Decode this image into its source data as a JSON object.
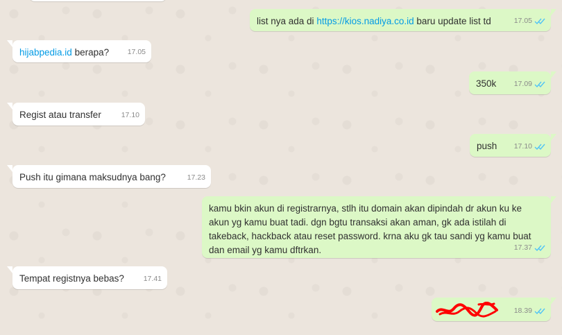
{
  "colors": {
    "background": "#ece5dd",
    "incoming_bubble": "#ffffff",
    "outgoing_bubble": "#dcf8c6",
    "link": "#039be5",
    "read_ticks": "#4fc3f7",
    "redaction": "#ff0000"
  },
  "messages": [
    {
      "direction": "out",
      "text_before": "list nya ada di ",
      "link": "https://kios.nadiya.co.id",
      "text_after": " baru update list td",
      "time": "17.05",
      "status": "read"
    },
    {
      "direction": "in",
      "link": "hijabpedia.id",
      "text_after": " berapa?",
      "time": "17.05"
    },
    {
      "direction": "out",
      "text": "350k",
      "time": "17.09",
      "status": "read"
    },
    {
      "direction": "in",
      "text": "Regist atau transfer",
      "time": "17.10"
    },
    {
      "direction": "out",
      "text": "push",
      "time": "17.10",
      "status": "read"
    },
    {
      "direction": "in",
      "text": "Push itu gimana maksudnya bang?",
      "time": "17.23"
    },
    {
      "direction": "out",
      "text": "kamu bkin akun di registrarnya, stlh itu domain akan dipindah dr akun ku ke akun yg kamu buat tadi. dgn bgtu transaksi akan aman, gk ada istilah di takeback, hackback atau reset password. krna aku gk tau sandi yg kamu buat dan email yg kamu dftrkan.",
      "time": "17.37",
      "status": "read"
    },
    {
      "direction": "in",
      "text": "Tempat registnya bebas?",
      "time": "17.41"
    },
    {
      "direction": "out",
      "content": "redacted-scribble",
      "time": "18.39",
      "status": "read"
    }
  ]
}
